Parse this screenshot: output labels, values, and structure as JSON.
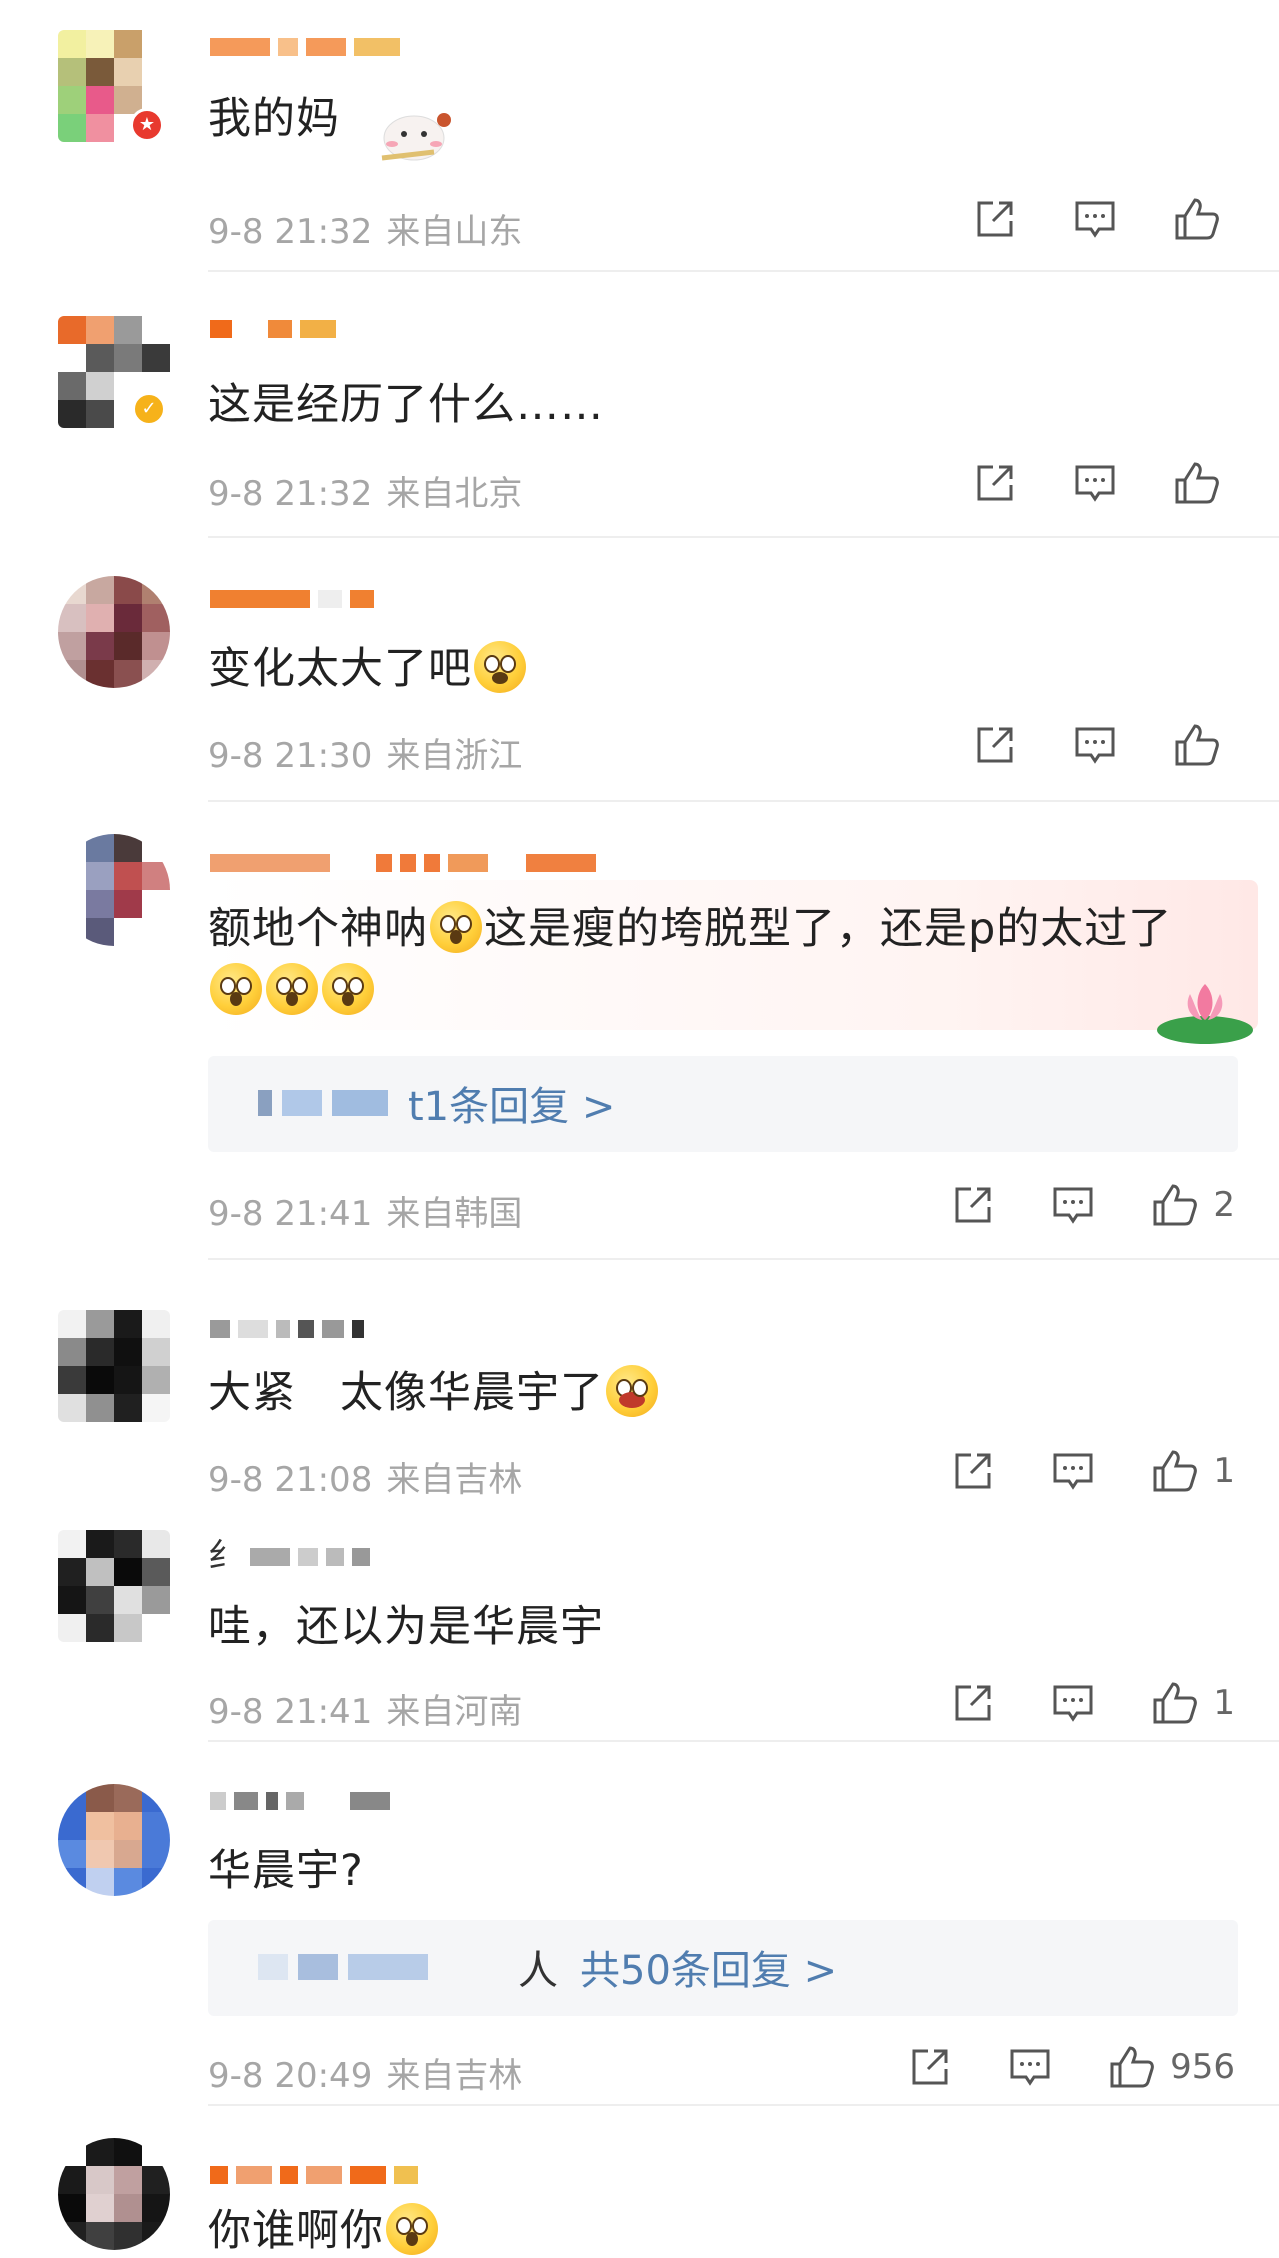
{
  "comments": [
    {
      "text": "我的妈",
      "time": "9-8 21:32",
      "location": "来自山东",
      "likes": ""
    },
    {
      "text": "这是经历了什么……",
      "time": "9-8 21:32",
      "location": "来自北京",
      "likes": ""
    },
    {
      "text": "变化太大了吧",
      "time": "9-8 21:30",
      "location": "来自浙江",
      "likes": ""
    },
    {
      "text": "额地个神呐",
      "text_b": "这是瘦的垮脱型了，还是p的太过了",
      "reply_link": "t1条回复 >",
      "time": "9-8 21:41",
      "location": "来自韩国",
      "likes": "2"
    },
    {
      "text": "大紧　太像华晨宇了",
      "time": "9-8 21:08",
      "location": "来自吉林",
      "likes": "1"
    },
    {
      "name_fragment": "纟",
      "text": "哇，还以为是华晨宇",
      "time": "9-8 21:41",
      "location": "来自河南",
      "likes": "1"
    },
    {
      "text": "华晨宇?",
      "reply_prefix": "人",
      "reply_link": "共50条回复 >",
      "time": "9-8 20:49",
      "location": "来自吉林",
      "likes": "956"
    },
    {
      "text": "你谁啊你",
      "time": "",
      "location": "",
      "likes": ""
    }
  ],
  "colors": {
    "meta_gray": "#a6a6a6",
    "link_blue": "#507daf",
    "reply_bg": "#f5f6f8",
    "icon_gray": "#555555"
  },
  "icons": [
    "share-icon",
    "comment-icon",
    "like-icon"
  ]
}
